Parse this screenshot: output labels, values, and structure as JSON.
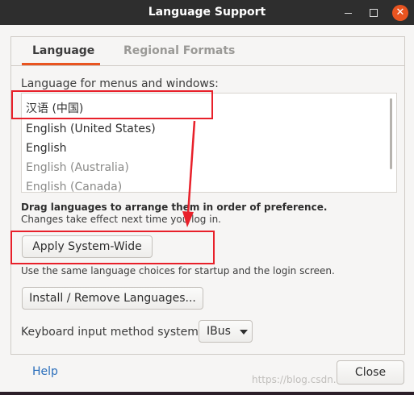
{
  "window": {
    "title": "Language Support"
  },
  "tabs": [
    {
      "label": "Language",
      "active": true
    },
    {
      "label": "Regional Formats",
      "active": false
    }
  ],
  "language_section": {
    "heading": "Language for menus and windows:",
    "items": [
      "汉语 (中国)",
      "English (United States)",
      "English",
      "English (Australia)",
      "English (Canada)"
    ],
    "note_bold": "Drag languages to arrange them in order of preference.",
    "note": "Changes take effect next time you log in.",
    "apply_label": "Apply System-Wide",
    "apply_desc": "Use the same language choices for startup and the login screen.",
    "install_label": "Install / Remove Languages...",
    "keyboard_label": "Keyboard input method system:",
    "keyboard_value": "IBus"
  },
  "footer": {
    "help_label": "Help",
    "close_label": "Close"
  },
  "watermark": "https://blog.csdn.net/dzcnull",
  "colors": {
    "accent": "#e95420",
    "titlebar": "#2e2e2e",
    "annotation": "#e8202a",
    "link": "#2a6ebb"
  },
  "icons": {
    "minimize": "minimize-icon",
    "maximize": "maximize-icon",
    "close": "close-icon",
    "dropdown": "chevron-down-icon"
  }
}
